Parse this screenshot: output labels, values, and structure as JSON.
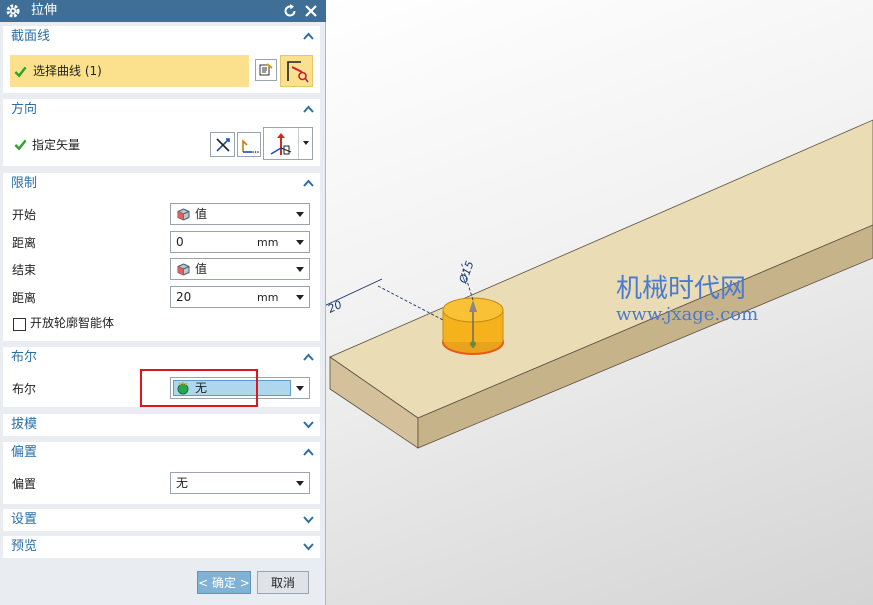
{
  "dialog": {
    "title": "拉伸"
  },
  "section_curve": {
    "title": "截面线",
    "select_label": "选择曲线 (1)"
  },
  "section_direction": {
    "title": "方向",
    "vector_label": "指定矢量"
  },
  "section_limits": {
    "title": "限制",
    "start_label": "开始",
    "start_value": "值",
    "distance_label_1": "距离",
    "distance_value_1": "0",
    "distance_unit_1": "mm",
    "end_label": "结束",
    "end_value": "值",
    "distance_label_2": "距离",
    "distance_value_2": "20",
    "distance_unit_2": "mm",
    "open_profile_label": "开放轮廓智能体"
  },
  "section_boolean": {
    "title": "布尔",
    "label": "布尔",
    "value": "无"
  },
  "section_draft": {
    "title": "拔模"
  },
  "section_offset": {
    "title": "偏置",
    "label": "偏置",
    "value": "无"
  },
  "section_settings": {
    "title": "设置"
  },
  "section_preview": {
    "title": "预览"
  },
  "buttons": {
    "ok": "< 确定 >",
    "cancel": "取消"
  },
  "viewport": {
    "watermark_cn": "机械时代网",
    "watermark_url": "www.jxage.com",
    "dim_label_1": "20",
    "dim_label_2": "Ø15"
  },
  "colors": {
    "accent_blue": "#2a6fa8",
    "selected_yellow": "#fbe08d",
    "highlight_red": "#e0141e",
    "board": "#eadcb4",
    "cylinder": "#f6b21c"
  }
}
